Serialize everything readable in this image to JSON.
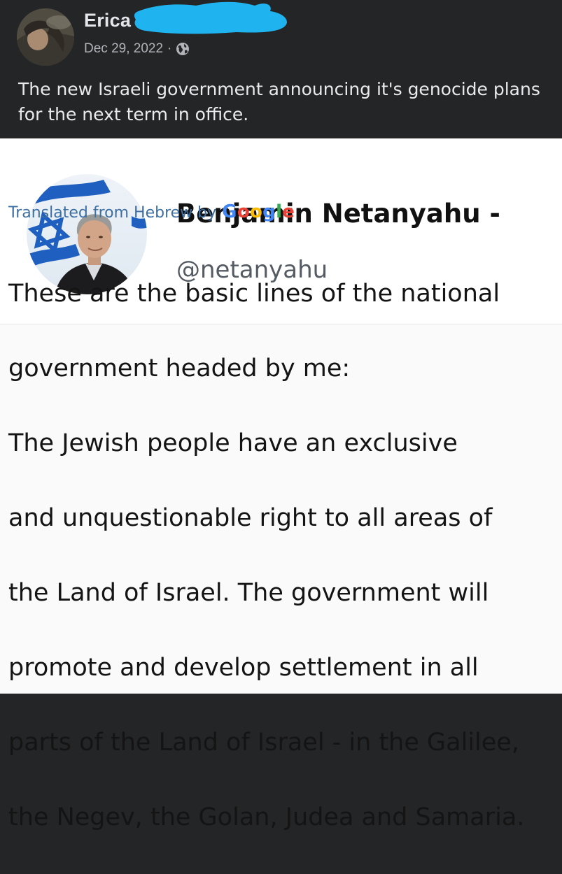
{
  "post": {
    "author_name": "Erica S",
    "date": "Dec 29, 2022",
    "separator": "·",
    "privacy_icon": "globe-icon",
    "text": "The new Israeli government announcing it's genocide plans for the next term in office."
  },
  "tweet": {
    "display_name": "Benjamin Netanyahu -",
    "handle": "@netanyahu",
    "translation_label": "Translated from Hebrew by",
    "translation_provider": {
      "letters": [
        {
          "char": "G",
          "color": "#4285F4"
        },
        {
          "char": "o",
          "color": "#EA4335"
        },
        {
          "char": "o",
          "color": "#FBBC05"
        },
        {
          "char": "g",
          "color": "#4285F4"
        },
        {
          "char": "l",
          "color": "#34A853"
        },
        {
          "char": "e",
          "color": "#EA4335"
        }
      ]
    },
    "body_lines": [
      "These are the basic lines of the national",
      "government headed by me:",
      "The Jewish people have an exclusive",
      "and unquestionable right to all areas of",
      "the Land of Israel. The government will",
      "promote and develop settlement in all",
      "parts of the Land of Israel - in the Galilee,",
      "the Negev, the Golan, Judea and Samaria."
    ]
  },
  "colors": {
    "facebook_dark_bg": "#242526",
    "redaction_blue": "#1fb4f0",
    "link_blue": "#3d6fa3"
  }
}
